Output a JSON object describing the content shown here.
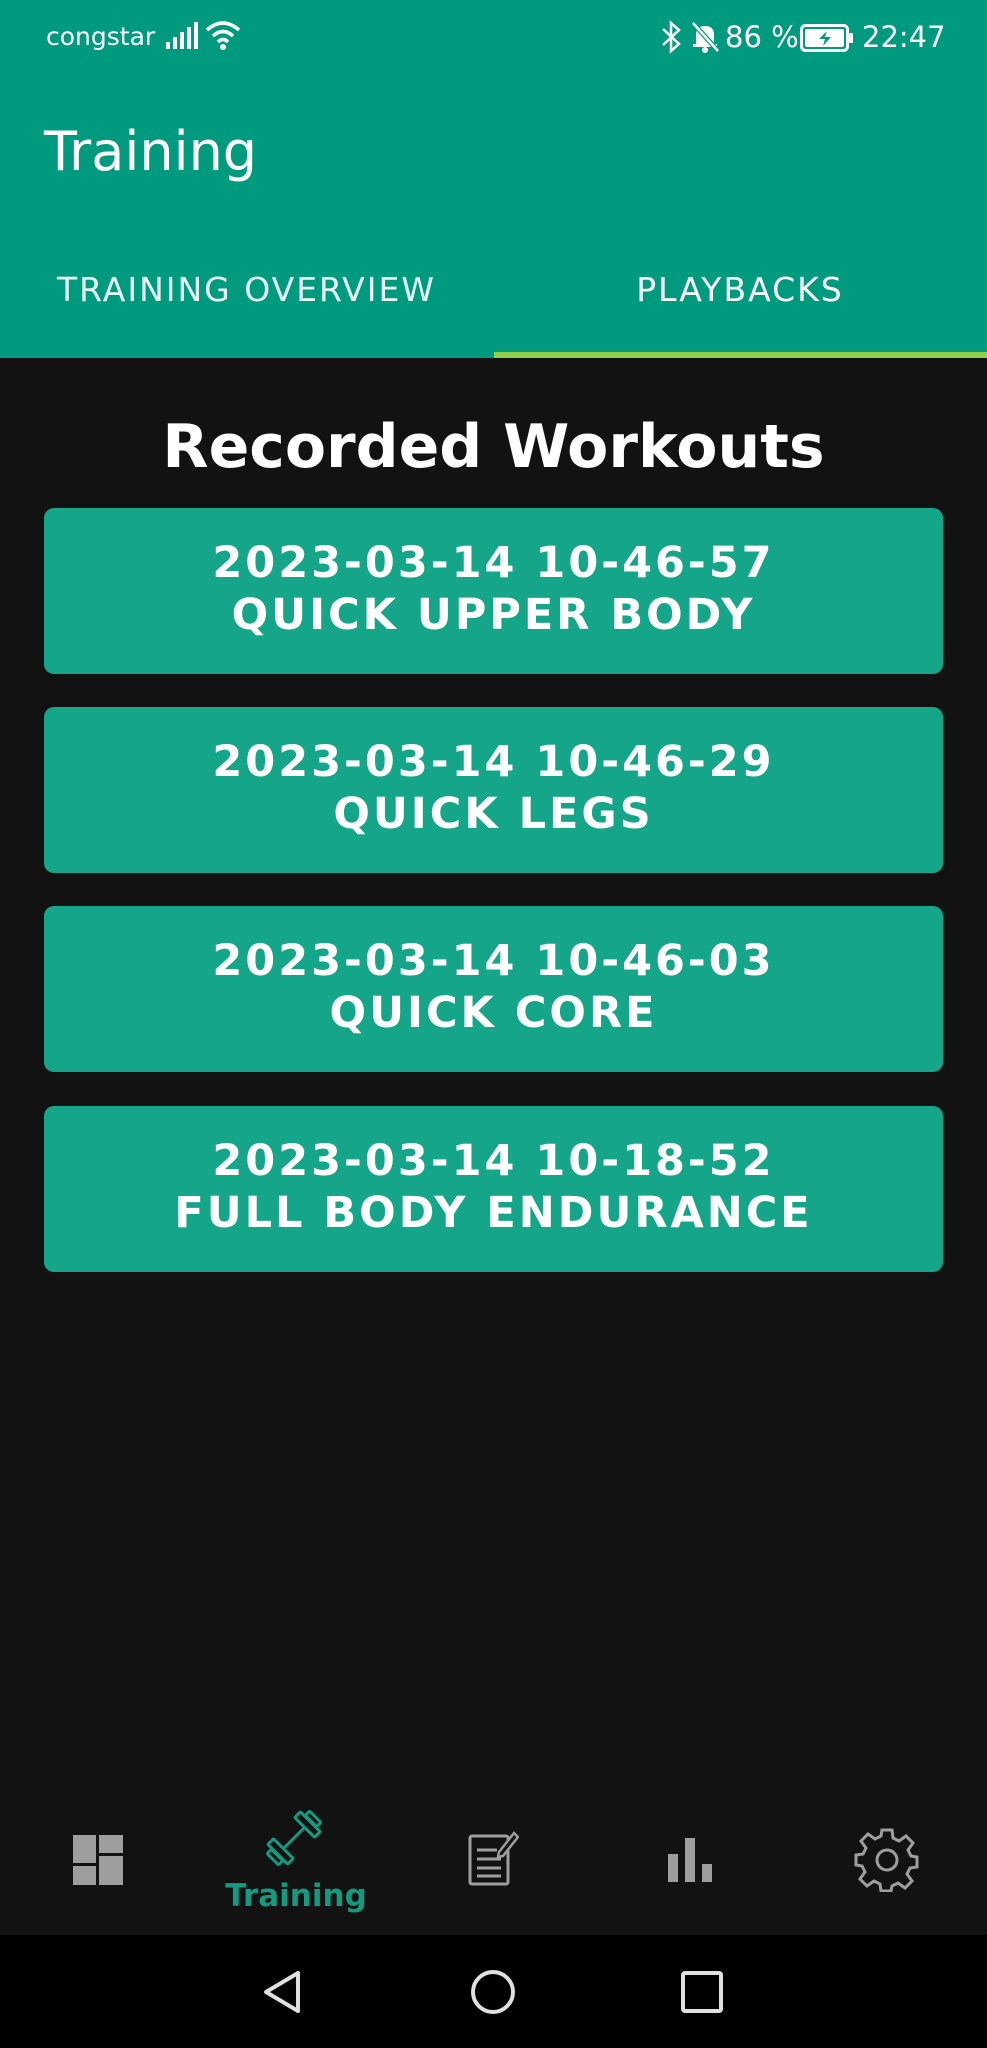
{
  "status_bar": {
    "carrier": "congstar",
    "battery_percent": "86 %",
    "time": "22:47",
    "icons": [
      "signal-icon",
      "wifi-icon",
      "bluetooth-icon",
      "bell-muted-icon",
      "battery-charging-icon"
    ]
  },
  "app_bar": {
    "title": "Training"
  },
  "tabs": [
    {
      "label": "TRAINING OVERVIEW",
      "selected": false
    },
    {
      "label": "PLAYBACKS",
      "selected": true
    }
  ],
  "content": {
    "heading": "Recorded Workouts",
    "workouts": [
      {
        "timestamp": "2023-03-14 10-46-57",
        "name": "QUICK UPPER BODY"
      },
      {
        "timestamp": "2023-03-14 10-46-29",
        "name": "QUICK LEGS"
      },
      {
        "timestamp": "2023-03-14 10-46-03",
        "name": "QUICK CORE"
      },
      {
        "timestamp": "2023-03-14 10-18-52",
        "name": "FULL BODY ENDURANCE"
      }
    ]
  },
  "bottom_nav": {
    "items": [
      {
        "icon": "dashboard-icon",
        "label": "",
        "active": false
      },
      {
        "icon": "dumbbell-icon",
        "label": "Training",
        "active": true
      },
      {
        "icon": "notes-edit-icon",
        "label": "",
        "active": false
      },
      {
        "icon": "bar-chart-icon",
        "label": "",
        "active": false
      },
      {
        "icon": "gear-icon",
        "label": "",
        "active": false
      }
    ]
  },
  "colors": {
    "header": "#009b7f",
    "card": "#15a589",
    "tab_indicator": "#8fd14f",
    "background": "#121212",
    "nav_active": "#139a7f",
    "nav_inactive": "#9e9e9e"
  }
}
